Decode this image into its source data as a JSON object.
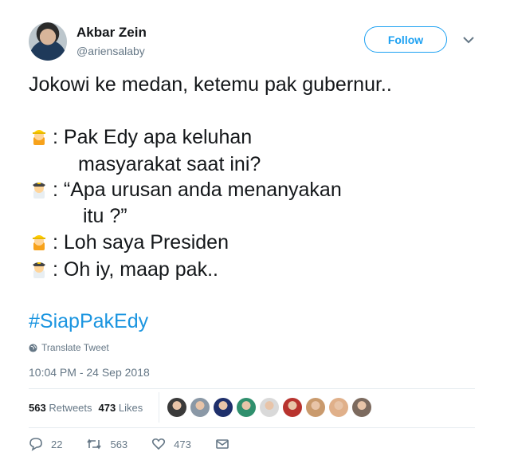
{
  "user": {
    "name": "Akbar Zein",
    "handle": "@ariensalaby"
  },
  "follow_label": "Follow",
  "tweet": {
    "lines": [
      "Jokowi ke medan, ketemu pak gubernur..",
      ": Pak Edy apa keluhan",
      "masyarakat saat ini?",
      ": “Apa urusan anda menanyakan",
      "itu ?”",
      ": Loh saya Presiden",
      ": Oh iy, maap pak.."
    ],
    "hashtag": "#SiapPakEdy"
  },
  "translate_label": "Translate Tweet",
  "timestamp": "10:04 PM - 24 Sep 2018",
  "stats": {
    "retweets_count": "563",
    "retweets_label": "Retweets",
    "likes_count": "473",
    "likes_label": "Likes"
  },
  "likers": [
    "#3a3a3a",
    "#8a98a6",
    "#1e2f6b",
    "#2f8f6d",
    "#d9d9d9",
    "#b8332e",
    "#c99a6d",
    "#e0b08a",
    "#7c6a5e"
  ],
  "actions": {
    "reply_count": "22",
    "retweet_count": "563",
    "like_count": "473"
  },
  "colors": {
    "accent": "#1da1f2",
    "hashtag": "#1b95e0",
    "muted": "#657786"
  },
  "icons": {
    "worker": "construction-worker-emoji",
    "police": "police-officer-emoji"
  }
}
